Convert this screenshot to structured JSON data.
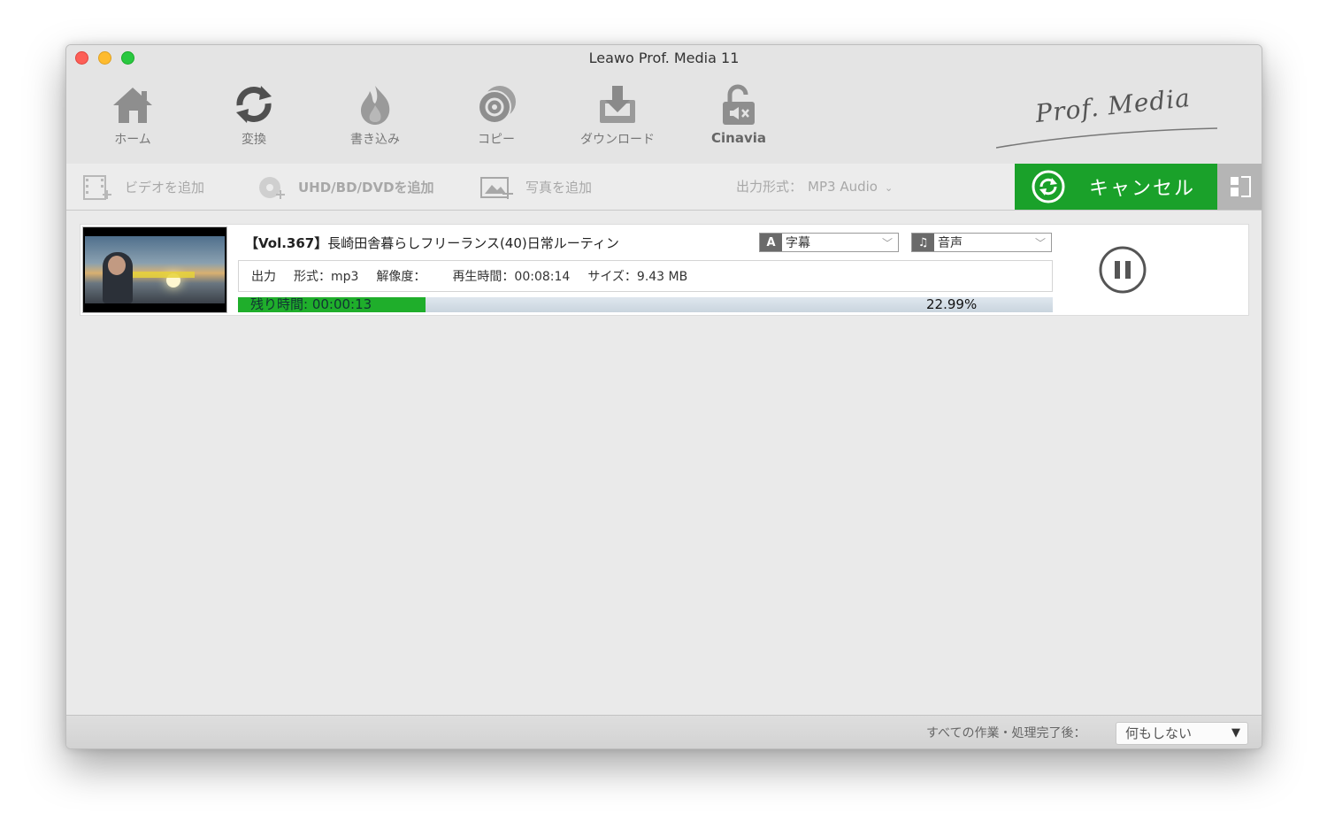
{
  "window": {
    "title": "Leawo Prof. Media 11"
  },
  "nav": [
    {
      "label": "ホーム",
      "icon": "home-icon"
    },
    {
      "label": "変換",
      "icon": "convert-icon"
    },
    {
      "label": "書き込み",
      "icon": "burn-icon"
    },
    {
      "label": "コピー",
      "icon": "copy-disc-icon"
    },
    {
      "label": "ダウンロード",
      "icon": "download-icon"
    },
    {
      "label": "Cinavia",
      "icon": "unlock-icon"
    }
  ],
  "brand": {
    "logo_text": "Prof. Media"
  },
  "subbar": {
    "add_video": "ビデオを追加",
    "add_disc": "UHD/BD/DVDを追加",
    "add_photo": "写真を追加",
    "output_format_label": "出力形式：",
    "output_format_value": "MP3 Audio",
    "cancel_label": "キャンセル"
  },
  "task": {
    "title_vol": "【Vol.367】",
    "title_text": "長崎田舎暮らしフリーランス(40)日常ルーティン",
    "subtitle_dropdown": "字幕",
    "audio_dropdown": "音声",
    "output_label": "出力",
    "format_label": "形式：mp3",
    "resolution_label": "解像度：",
    "duration_label": "再生時間：00:08:14",
    "size_label": "サイズ：9.43 MB",
    "remaining": "残り時間: 00:00:13",
    "progress_percent_text": "22.99%",
    "progress_fraction": 0.2299
  },
  "status": {
    "after_label": "すべての作業・処理完了後：",
    "after_value": "何もしない"
  },
  "colors": {
    "accent_green": "#1aa12a",
    "progress_green": "#1fae2b"
  }
}
